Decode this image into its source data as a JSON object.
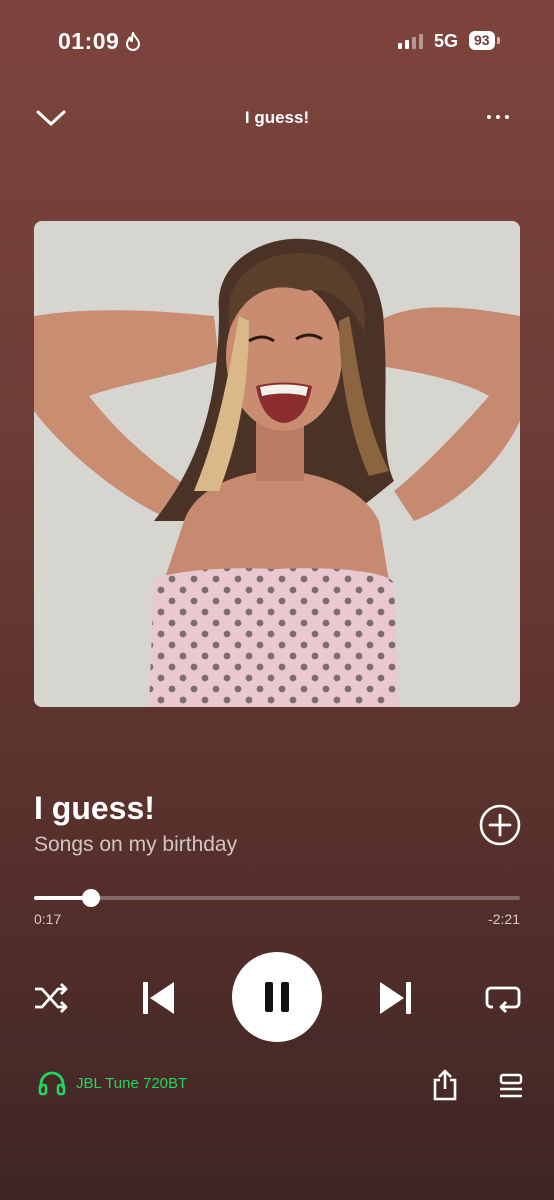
{
  "status_bar": {
    "time": "01:09",
    "network": "5G",
    "battery": "93"
  },
  "header": {
    "title": "I guess!"
  },
  "track": {
    "title": "I guess!",
    "subtitle": "Songs on my birthday"
  },
  "progress": {
    "elapsed": "0:17",
    "remaining": "-2:21",
    "fraction": 0.117
  },
  "device": {
    "name": "JBL Tune 720BT",
    "color": "#1ed760"
  },
  "colors": {
    "background_top": "#7d443d",
    "background_bottom": "#3f2624",
    "accent": "#1ed760"
  }
}
